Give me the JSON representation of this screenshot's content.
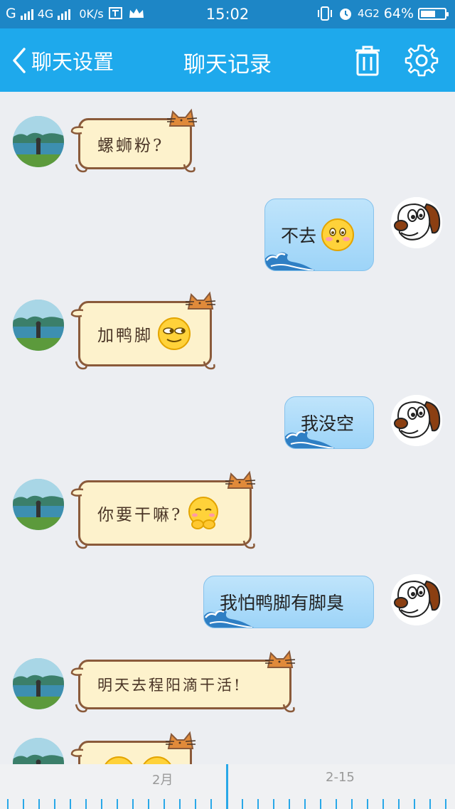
{
  "status_bar": {
    "carrier1": "G",
    "network": "4G",
    "speed": "0K/s",
    "time": "15:02",
    "network2": "4G2",
    "battery": "64%",
    "battery_level": 0.64
  },
  "header": {
    "back_label": "聊天设置",
    "title": "聊天记录",
    "delete_icon": "trash-icon",
    "settings_icon": "gear-icon"
  },
  "messages": [
    {
      "side": "left",
      "text": "螺蛳粉?",
      "emoji": ""
    },
    {
      "side": "right",
      "text": "不去",
      "emoji": "blush-face"
    },
    {
      "side": "left",
      "text": "加鸭脚",
      "emoji": "smirk-face"
    },
    {
      "side": "right",
      "text": "我没空",
      "emoji": ""
    },
    {
      "side": "left",
      "text": "你要干嘛?",
      "emoji": "shy-face"
    },
    {
      "side": "right",
      "text": "我怕鸭脚有脚臭",
      "emoji": ""
    },
    {
      "side": "left",
      "text": "明天去程阳滴干活!",
      "emoji": ""
    },
    {
      "side": "left",
      "text": "",
      "emoji": "faces-partial"
    }
  ],
  "timeline": {
    "month_label": "2月",
    "date_label": "2-15"
  },
  "colors": {
    "status_bar": "#1d86c6",
    "title_bar": "#1ea9ec",
    "background": "#eceef2",
    "accent": "#29a8e8"
  }
}
